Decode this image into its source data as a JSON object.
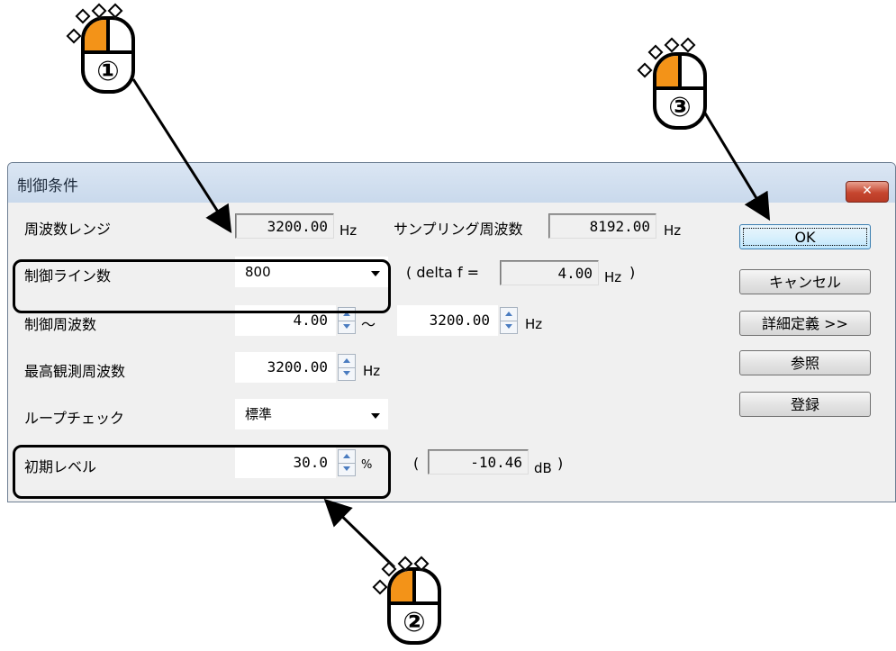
{
  "dialog": {
    "title": "制御条件",
    "close_glyph": "✕"
  },
  "rows": {
    "freq_range": {
      "label": "周波数レンジ",
      "value": "3200.00",
      "unit": "Hz"
    },
    "sampling": {
      "label": "サンプリング周波数",
      "value": "8192.00",
      "unit": "Hz"
    },
    "lines": {
      "label": "制御ライン数",
      "value": "800",
      "delta_prefix": "( delta f =",
      "delta_value": "4.00",
      "delta_unit": "Hz",
      "delta_close": ")"
    },
    "ctrl_freq": {
      "label": "制御周波数",
      "from": "4.00",
      "tilde": "～",
      "to": "3200.00",
      "unit": "Hz"
    },
    "max_freq": {
      "label": "最高観測周波数",
      "value": "3200.00",
      "unit": "Hz"
    },
    "loop_check": {
      "label": "ループチェック",
      "value": "標準"
    },
    "init_level": {
      "label": "初期レベル",
      "value": "30.0",
      "unit": "%",
      "db_open": "(",
      "db_value": "-10.46",
      "db_unit": "dB",
      "db_close": ")"
    }
  },
  "buttons": {
    "ok": "OK",
    "cancel": "キャンセル",
    "advanced": "詳細定義 >>",
    "browse": "参照",
    "register": "登録"
  },
  "callouts": [
    "①",
    "②",
    "③"
  ],
  "colors": {
    "mouse_button": "#f39318",
    "close_button": "#c6462f",
    "titlebar": "#c9d9ec"
  }
}
